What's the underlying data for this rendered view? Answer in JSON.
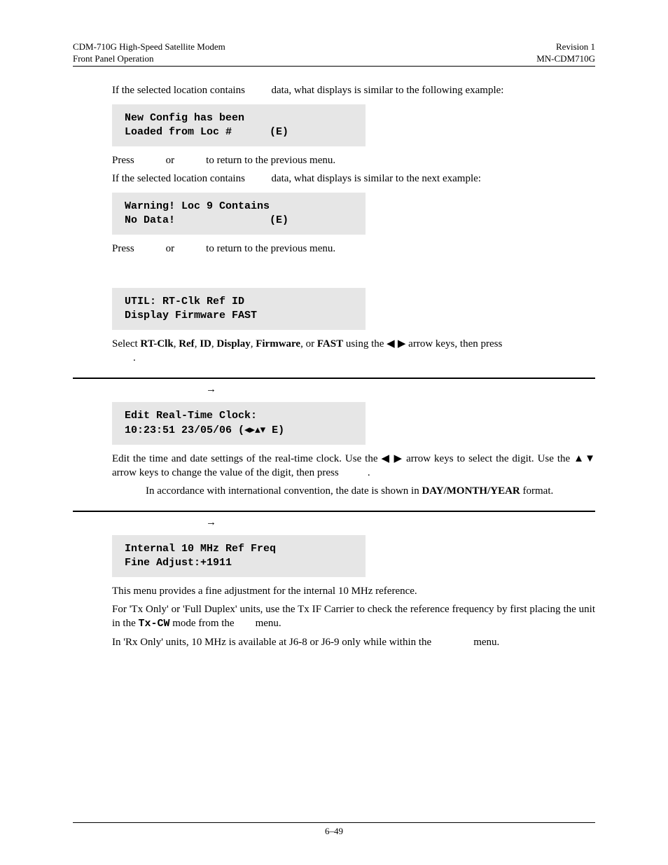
{
  "header": {
    "left1": "CDM-710G High-Speed Satellite Modem",
    "left2": "Front Panel Operation",
    "right1": "Revision 1",
    "right2": "MN-CDM710G"
  },
  "p1_a": "If the selected location contains ",
  "p1_b": " data, what displays is similar to the following example:",
  "box1": "New Config has been\nLoaded from Loc #      (E)",
  "p2_a": "Press ",
  "p2_b": " or ",
  "p2_c": " to return to the previous menu.",
  "p3_a": "If the selected location contains ",
  "p3_b": " data, what displays is similar to the next example:",
  "box2": "Warning! Loc 9 Contains\nNo Data!               (E)",
  "p4_a": "Press ",
  "p4_b": " or ",
  "p4_c": " to return to the previous menu.",
  "box3": "UTIL: RT-Clk Ref ID\nDisplay Firmware FAST",
  "p5_a": "Select ",
  "p5_rt": "RT-Clk",
  "p5_ref": "Ref",
  "p5_id": "ID",
  "p5_disp": "Display",
  "p5_fw": "Firmware",
  "p5_or": ", or ",
  "p5_fast": "FAST",
  "p5_b": " using the ",
  "p5_arrows": "◀ ▶",
  "p5_c": " arrow keys, then press ",
  "p5_end": ".",
  "h1_arrow": "→",
  "box4_l1": "Edit Real-Time Clock:",
  "box4_l2a": "10:23:51 23/05/06 (",
  "box4_arrows": "◂▸▴▾",
  "box4_l2b": " E)",
  "p6_a": "Edit the time and date settings of  the real-time clock. Use the ",
  "p6_lr": "◀ ▶",
  "p6_b": " arrow keys to select the digit. Use the ",
  "p6_ud": "▲▼",
  "p6_c": " arrow keys to change the value of the digit, then press ",
  "p6_d": ".",
  "p7_a": "In accordance with international convention, the date is shown in ",
  "p7_dmy": "DAY/MONTH/YEAR",
  "p7_b": " format.",
  "h2_arrow": "→",
  "box5": "Internal 10 MHz Ref Freq\nFine Adjust:+1911",
  "p8": "This menu provides a fine adjustment for the internal 10 MHz reference.",
  "p9_a": "For 'Tx Only' or 'Full Duplex' units, use the Tx IF Carrier to check the reference frequency by first placing the unit in the ",
  "p9_txcw": "Tx-CW",
  "p9_b": " mode from the ",
  "p9_c": " menu.",
  "p10_a": "In 'Rx Only' units, 10 MHz is available at J6-8 or J6-9 only while within the ",
  "p10_b": " menu.",
  "footer_page": "6–49"
}
